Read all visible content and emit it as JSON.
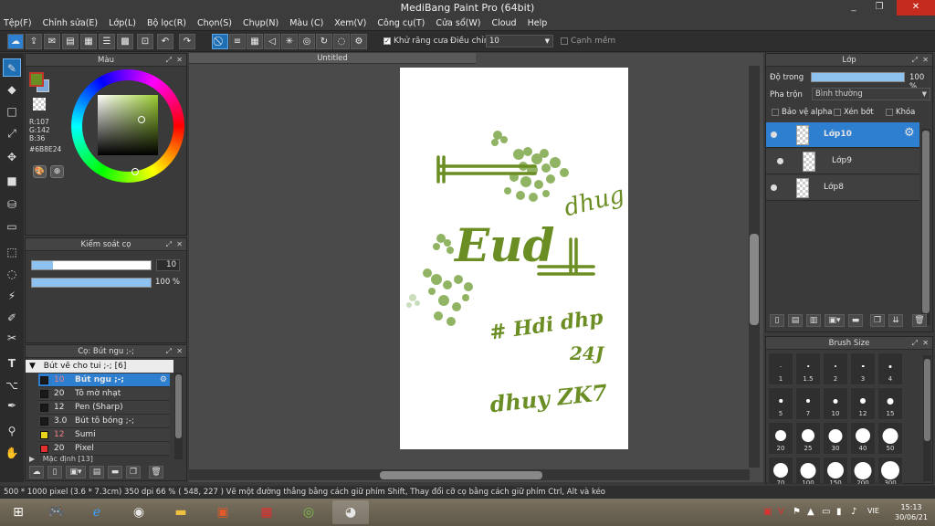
{
  "app": {
    "title": "MediBang Paint Pro (64bit)",
    "win_min": "_",
    "win_max": "❐",
    "win_close": "✕"
  },
  "menu": [
    "Tệp(F)",
    "Chỉnh sửa(E)",
    "Lớp(L)",
    "Bộ lọc(R)",
    "Chọn(S)",
    "Chụp(N)",
    "Màu (C)",
    "Xem(V)",
    "Công cụ(T)",
    "Cửa sổ(W)",
    "Cloud",
    "Help"
  ],
  "toolbar": {
    "antialias_label": "Khử răng cưa",
    "adjust_label": "Điều chỉnh",
    "adjust_value": "10",
    "edge_label": "Cạnh mềm"
  },
  "color_panel": {
    "title": "Màu",
    "r": "R:107",
    "g": "G:142",
    "b": "B:36",
    "hex": "#6B8E24",
    "colors": {
      "fg": "#6b8e24",
      "bg": "#7ba7d9",
      "accent": "#2f7fd0"
    }
  },
  "brush_control": {
    "title": "Kiểm soát cọ",
    "size_value": "10",
    "size_fraction": 0.18,
    "opacity_value": "100 %",
    "opacity_fraction": 1.0
  },
  "brush_panel": {
    "title": "Cọ: Bút ngu ;-;",
    "group": "Bút vẽ cho tui ;-; [6]",
    "brushes": [
      {
        "size": "10",
        "name": "Bút ngu ;-;",
        "color": "#1a1a1a"
      },
      {
        "size": "20",
        "name": "Tô mờ nhạt",
        "color": "#1a1a1a"
      },
      {
        "size": "12",
        "name": "Pen (Sharp)",
        "color": "#1a1a1a"
      },
      {
        "size": "3.0",
        "name": "Bút tô bóng ;-;",
        "color": "#1a1a1a"
      },
      {
        "size": "12",
        "name": "Sumi",
        "color": "#e8d21a"
      },
      {
        "size": "20",
        "name": "Pixel",
        "color": "#e03030"
      }
    ],
    "next_group": "Mặc định [13]"
  },
  "document": {
    "tab": "Untitled",
    "texts": {
      "t1": "Eud",
      "t2": "dhug",
      "t3": "# Hdi dhp",
      "t4": "24J",
      "t5": "dhuy ZK7"
    }
  },
  "layer_panel": {
    "title": "Lớp",
    "opacity_label": "Độ trong",
    "opacity_value": "100 %",
    "opacity_fraction": 1.0,
    "blend_label": "Pha trộn",
    "blend_value": "Bình thường",
    "protect_alpha": "Bảo vệ alpha",
    "clip": "Xén bớt",
    "lock": "Khóa",
    "layers": [
      {
        "name": "Lớp10",
        "selected": true
      },
      {
        "name": "Lớp9",
        "selected": false
      },
      {
        "name": "Lớp8",
        "selected": false
      }
    ]
  },
  "brush_size_panel": {
    "title": "Brush Size",
    "rows": [
      [
        "1",
        "1.5",
        "2",
        "3",
        "4"
      ],
      [
        "5",
        "7",
        "10",
        "12",
        "15"
      ],
      [
        "20",
        "25",
        "30",
        "40",
        "50"
      ],
      [
        "70",
        "100",
        "150",
        "200",
        "300"
      ]
    ]
  },
  "status": {
    "text": "500 * 1000 pixel  (3.6 * 7.3cm)  350 dpi  66 %  ( 548, 227 )  Vẽ một đường thẳng bằng cách giữ phím Shift, Thay đổi cỡ cọ bằng cách giữ phím Ctrl, Alt và kéo"
  },
  "taskbar": {
    "lang": "VIE",
    "time": "15:13",
    "date": "30/06/21"
  }
}
